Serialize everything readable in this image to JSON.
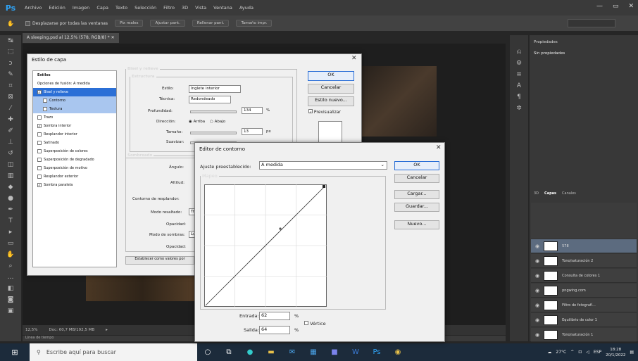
{
  "app": {
    "logo": "Ps",
    "window_controls": [
      "—",
      "▭",
      "✕"
    ]
  },
  "menu": [
    "Archivo",
    "Edición",
    "Imagen",
    "Capa",
    "Texto",
    "Selección",
    "Filtro",
    "3D",
    "Vista",
    "Ventana",
    "Ayuda"
  ],
  "options_bar": {
    "items": [
      "Desplazarse por todas las ventanas",
      "Pix reales",
      "Ajustar pant.",
      "Rellenar pant.",
      "Tamaño impr."
    ]
  },
  "document_tab": "A sleeping.psd al 12,5% (578, RGB/8) * ✕",
  "status_bar": {
    "zoom": "12,5%",
    "doc": "Doc: 60,7 MB/192,5 MB",
    "timeline": "Línea de tiempo"
  },
  "properties": {
    "tab": "Propiedades",
    "body": "Sin propiedades"
  },
  "layers": {
    "tabs": [
      "3D",
      "Capas",
      "Canales"
    ],
    "rows": [
      {
        "name": "578",
        "selected": true
      },
      {
        "name": "Tono/saturación 2"
      },
      {
        "name": "Consulta de colores 1"
      },
      {
        "name": "pngwing.com"
      },
      {
        "name": "Filtro de fotografí..."
      },
      {
        "name": "Equilibrio de color 1"
      },
      {
        "name": "Tono/saturación 1"
      }
    ]
  },
  "layer_style": {
    "title": "Estilo de capa",
    "styles": [
      {
        "label": "Estilos",
        "kind": "head"
      },
      {
        "label": "Opciones de fusión: A medida",
        "kind": "plain"
      },
      {
        "label": "Bisel y relieve",
        "kind": "sel",
        "checked": true
      },
      {
        "label": "Contorno",
        "kind": "sub",
        "checked": false
      },
      {
        "label": "Textura",
        "kind": "sub",
        "checked": false
      },
      {
        "label": "Trazo",
        "kind": "plain",
        "checked": false
      },
      {
        "label": "Sombra interior",
        "kind": "plain",
        "checked": true
      },
      {
        "label": "Resplandor interior",
        "kind": "plain",
        "checked": false
      },
      {
        "label": "Satinado",
        "kind": "plain",
        "checked": false
      },
      {
        "label": "Superposición de colores",
        "kind": "plain",
        "checked": false
      },
      {
        "label": "Superposición de degradado",
        "kind": "plain",
        "checked": false
      },
      {
        "label": "Superposición de motivo",
        "kind": "plain",
        "checked": false
      },
      {
        "label": "Resplandor exterior",
        "kind": "plain",
        "checked": false
      },
      {
        "label": "Sombra paralela",
        "kind": "plain",
        "checked": true
      }
    ],
    "bevel_title": "Bisel y relieve",
    "structure": "Estructura",
    "estilo_label": "Estilo:",
    "estilo_value": "Inglete interior",
    "tecnica_label": "Técnica:",
    "tecnica_value": "Redondeado",
    "profundidad_label": "Profundidad:",
    "profundidad_value": "134",
    "percent": "%",
    "direccion_label": "Dirección:",
    "dir_arriba": "Arriba",
    "dir_abajo": "Abajo",
    "tamano_label": "Tamaño:",
    "tamano_value": "13",
    "px": "px",
    "suavizar_label": "Suavizar:",
    "shading": "Sombreado",
    "angulo_label": "Ángulo:",
    "altitud_label": "Altitud:",
    "contorno_label": "Contorno de resplandor:",
    "modo_resaltado_label": "Modo resaltado:",
    "modo_resaltado_value": "Tr",
    "opacidad1_label": "Opacidad:",
    "modo_sombra_label": "Modo de sombras:",
    "modo_sombra_value": "Lu",
    "opacidad2_label": "Opacidad:",
    "defaults_btn": "Establecer como valores por",
    "ok": "OK",
    "cancel": "Cancelar",
    "new_style": "Estilo nuevo...",
    "preview": "Previsualizar"
  },
  "contour_editor": {
    "title": "Editor de contorno",
    "preset_label": "Ajuste preestablecido:",
    "preset_value": "A medida",
    "mapping": "Mapeo",
    "entrada_label": "Entrada:",
    "entrada_value": "62",
    "salida_label": "Salida:",
    "salida_value": "64",
    "percent": "%",
    "vertice": "Vértice",
    "ok": "OK",
    "cancel": "Cancelar",
    "load": "Cargar...",
    "save": "Guardar...",
    "new": "Nuevo..."
  },
  "taskbar": {
    "search_placeholder": "Escribe aquí para buscar",
    "weather": "27°C",
    "lang": "ESP",
    "time": "18:28",
    "date": "20/1/2022"
  }
}
